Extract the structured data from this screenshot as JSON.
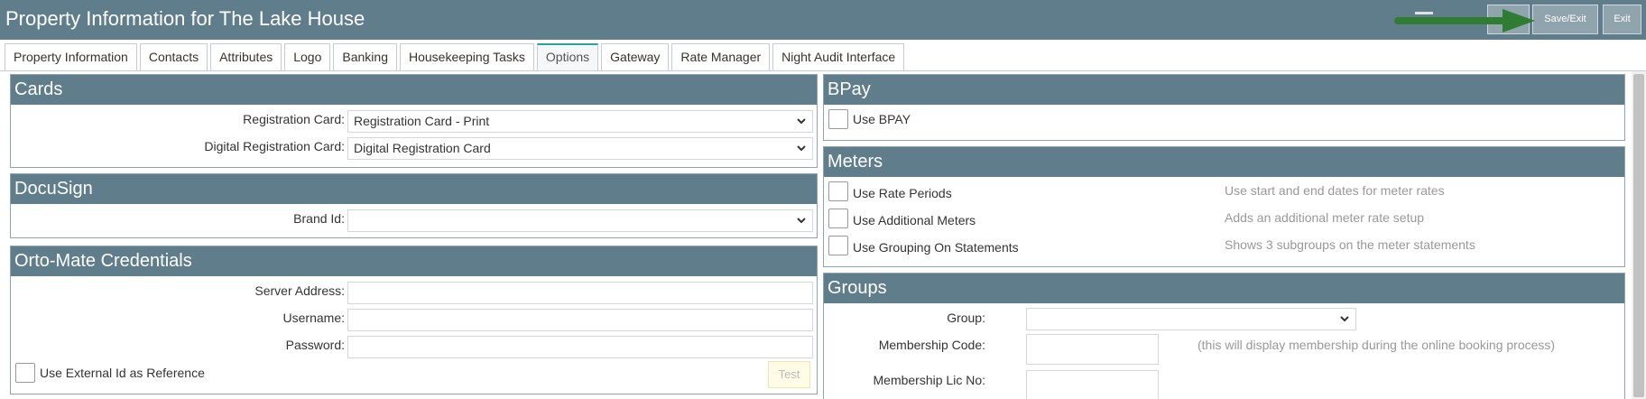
{
  "header": {
    "title": "Property Information for The Lake House",
    "save_exit_label": "Save/Exit",
    "exit_label": "Exit",
    "arrow_color": "#2e7d32"
  },
  "tabs": [
    {
      "label": "Property Information"
    },
    {
      "label": "Contacts"
    },
    {
      "label": "Attributes"
    },
    {
      "label": "Logo"
    },
    {
      "label": "Banking"
    },
    {
      "label": "Housekeeping Tasks"
    },
    {
      "label": "Options",
      "active": true
    },
    {
      "label": "Gateway"
    },
    {
      "label": "Rate Manager"
    },
    {
      "label": "Night Audit Interface"
    }
  ],
  "cards": {
    "title": "Cards",
    "registration_card_label": "Registration Card:",
    "registration_card_value": "Registration Card - Print",
    "digital_registration_card_label": "Digital Registration Card:",
    "digital_registration_card_value": "Digital Registration Card"
  },
  "docusign": {
    "title": "DocuSign",
    "brand_id_label": "Brand Id:",
    "brand_id_value": ""
  },
  "ortomate": {
    "title": "Orto-Mate Credentials",
    "server_address_label": "Server Address:",
    "username_label": "Username:",
    "password_label": "Password:",
    "use_external_id_label": "Use External Id as Reference",
    "test_button_label": "Test"
  },
  "bpay": {
    "title": "BPay",
    "use_bpay_label": "Use BPAY"
  },
  "meters": {
    "title": "Meters",
    "options": [
      {
        "label": "Use Rate Periods",
        "hint": "Use start and end dates for meter rates"
      },
      {
        "label": "Use Additional Meters",
        "hint": "Adds an additional meter rate setup"
      },
      {
        "label": "Use Grouping On Statements",
        "hint": "Shows 3 subgroups on the meter statements"
      }
    ]
  },
  "groups": {
    "title": "Groups",
    "group_label": "Group:",
    "group_value": "",
    "membership_code_label": "Membership Code:",
    "membership_code_hint": "(this will display membership during the online booking process)",
    "membership_lic_label": "Membership Lic No:"
  }
}
